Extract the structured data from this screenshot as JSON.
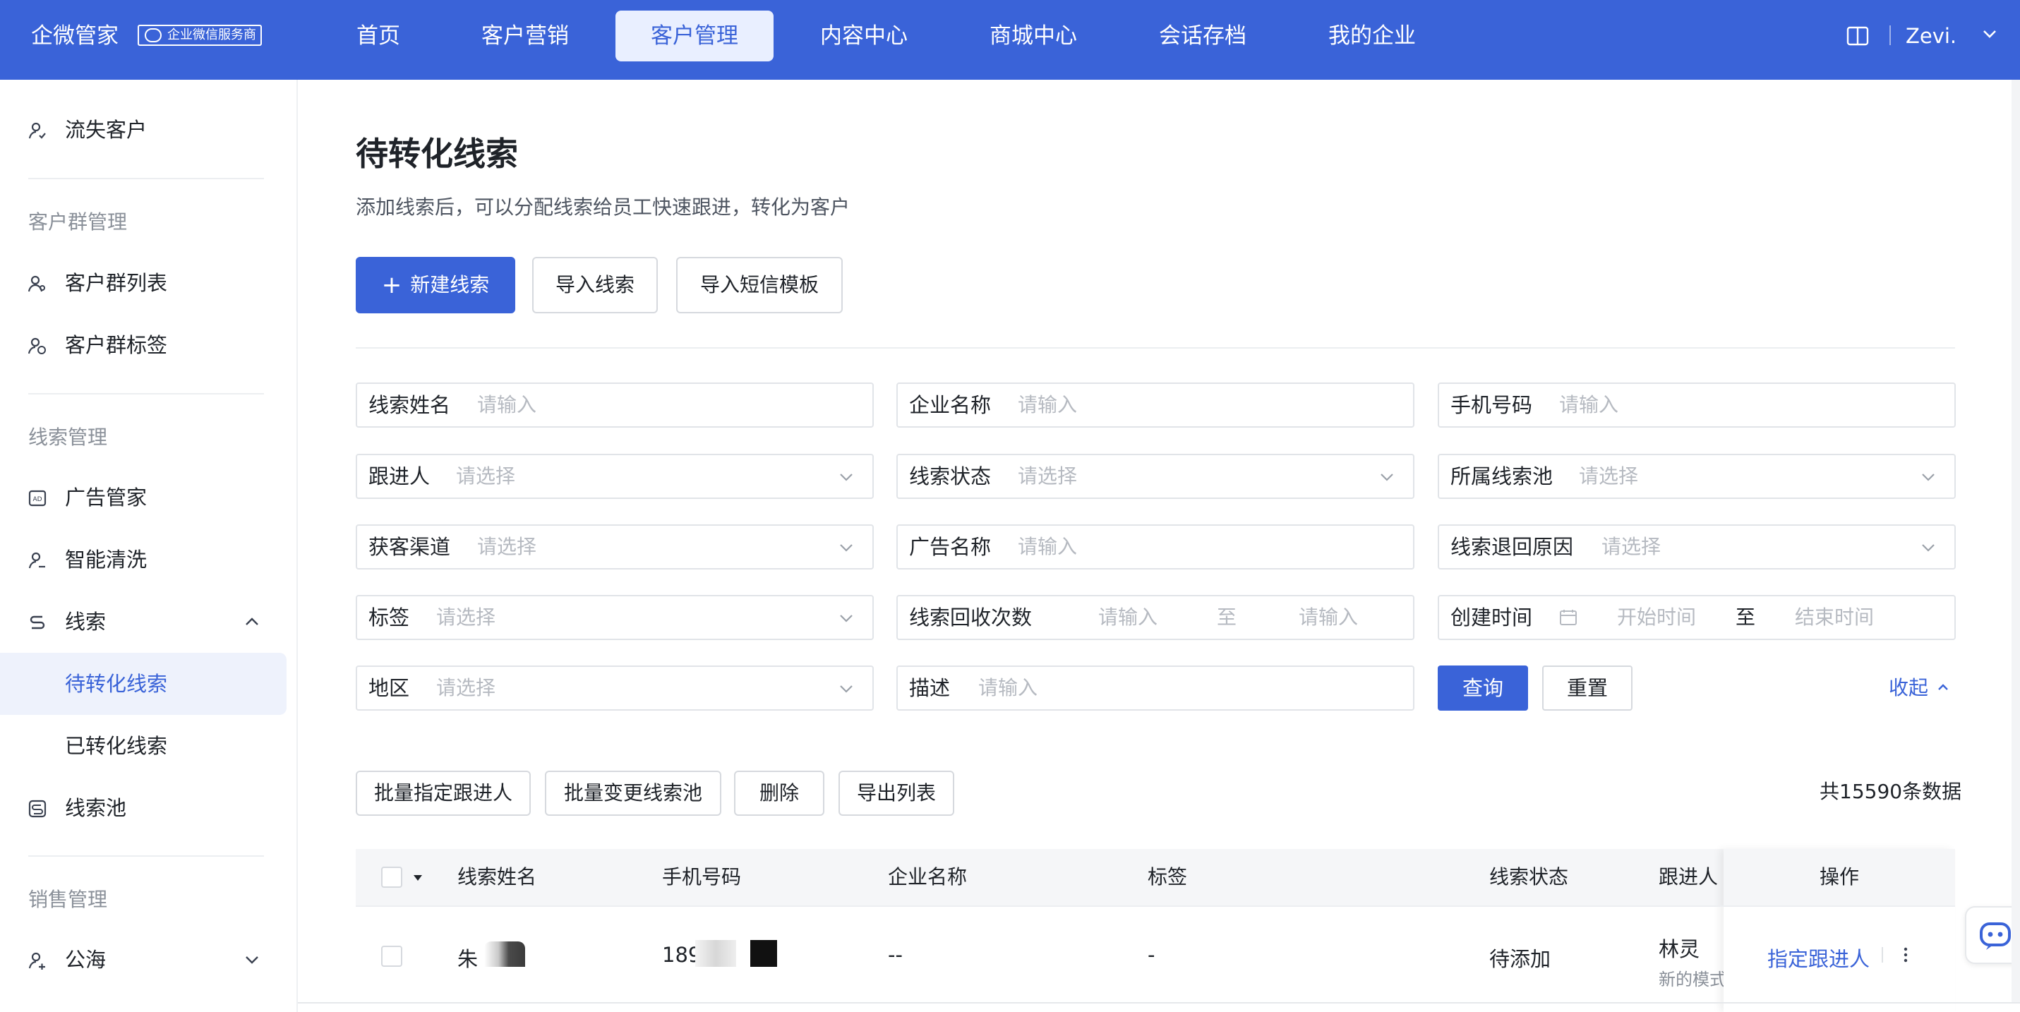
{
  "header": {
    "logo_text": "企微管家",
    "logo_badge": "企业微信服务商",
    "nav": [
      "首页",
      "客户营销",
      "客户管理",
      "内容中心",
      "商城中心",
      "会话存档",
      "我的企业"
    ],
    "active_nav": "客户管理",
    "user_name": "Zevi."
  },
  "sidebar": {
    "item_lost_customers": "流失客户",
    "section_group": "客户群管理",
    "item_group_list": "客户群列表",
    "item_group_tags": "客户群标签",
    "section_leads": "线索管理",
    "item_ad_manager": "广告管家",
    "item_smart_clean": "智能清洗",
    "item_leads": "线索",
    "sub_pending": "待转化线索",
    "sub_converted": "已转化线索",
    "item_lead_pool": "线索池",
    "section_sales": "销售管理",
    "item_high_seas": "公海"
  },
  "page": {
    "title": "待转化线索",
    "description": "添加线索后，可以分配线索给员工快速跟进，转化为客户",
    "btn_new": "新建线索",
    "btn_import": "导入线索",
    "btn_import_sms": "导入短信模板"
  },
  "filters": {
    "lead_name": {
      "label": "线索姓名",
      "placeholder": "请输入"
    },
    "company": {
      "label": "企业名称",
      "placeholder": "请输入"
    },
    "phone": {
      "label": "手机号码",
      "placeholder": "请输入"
    },
    "follower": {
      "label": "跟进人",
      "placeholder": "请选择"
    },
    "lead_status": {
      "label": "线索状态",
      "placeholder": "请选择"
    },
    "lead_pool": {
      "label": "所属线索池",
      "placeholder": "请选择"
    },
    "channel": {
      "label": "获客渠道",
      "placeholder": "请选择"
    },
    "ad_name": {
      "label": "广告名称",
      "placeholder": "请输入"
    },
    "return_reason": {
      "label": "线索退回原因",
      "placeholder": "请选择"
    },
    "tags": {
      "label": "标签",
      "placeholder": "请选择"
    },
    "recycle_count": {
      "label": "线索回收次数",
      "from_placeholder": "请输入",
      "to_text": "至",
      "to_placeholder": "请输入"
    },
    "created_time": {
      "label": "创建时间",
      "start_placeholder": "开始时间",
      "to_text": "至",
      "end_placeholder": "结束时间"
    },
    "region": {
      "label": "地区",
      "placeholder": "请选择"
    },
    "description": {
      "label": "描述",
      "placeholder": "请输入"
    },
    "btn_query": "查询",
    "btn_reset": "重置",
    "collapse": "收起"
  },
  "batch": {
    "assign_follower": "批量指定跟进人",
    "change_pool": "批量变更线索池",
    "delete": "删除",
    "export": "导出列表",
    "total": "共15590条数据"
  },
  "table": {
    "columns": [
      "线索姓名",
      "手机号码",
      "企业名称",
      "标签",
      "线索状态",
      "跟进人",
      "操作"
    ],
    "rows": [
      {
        "name": "朱",
        "phone": "189",
        "company": "--",
        "tags": "-",
        "status": "待添加",
        "follower": "林灵",
        "follower_sub": "新的模式",
        "action": "指定跟进人"
      }
    ]
  },
  "colors": {
    "primary": "#3a63d8",
    "nav_active_bg": "#e9efff",
    "sidebar_active_bg": "#eef2fc"
  },
  "icons": [
    "book-icon",
    "user-icon",
    "group-icon",
    "ad-icon",
    "clean-icon",
    "lead-icon",
    "pool-icon",
    "calendar-icon",
    "chevron-down-icon",
    "chevron-up-icon",
    "more-icon",
    "chat-bot-icon"
  ]
}
